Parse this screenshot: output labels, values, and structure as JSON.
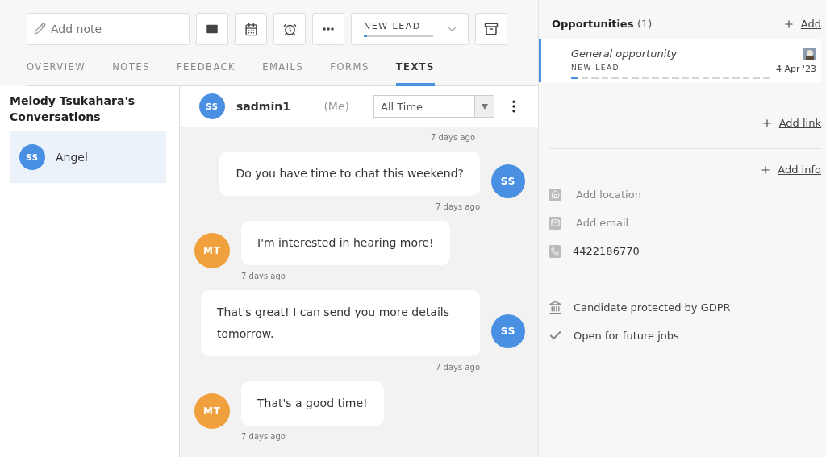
{
  "toolbar": {
    "note": {
      "placeholder": "Add note"
    },
    "stage": {
      "label": "NEW LEAD",
      "level": 0.05
    }
  },
  "tabs": [
    {
      "label": "OVERVIEW",
      "selected": false
    },
    {
      "label": "NOTES",
      "selected": false
    },
    {
      "label": "FEEDBACK",
      "selected": false
    },
    {
      "label": "EMAILS",
      "selected": false
    },
    {
      "label": "FORMS",
      "selected": false
    },
    {
      "label": "TEXTS",
      "selected": true
    }
  ],
  "conversations": {
    "title": "Melody Tsukahara's Conversations",
    "items": [
      {
        "initials": "SS",
        "name": "Angel",
        "color": "#4a90e2",
        "selected": true
      }
    ]
  },
  "chat": {
    "user": {
      "initials": "SS",
      "name": "sadmin1",
      "note": "(Me)",
      "color": "#4a90e2"
    },
    "period": "All Time",
    "messages": [
      {
        "kind": "time",
        "time": "7 days ago"
      },
      {
        "kind": "out",
        "text": "Do you have time to chat this weekend?",
        "time": "7 days ago",
        "initials": "SS",
        "color": "#4a90e2"
      },
      {
        "kind": "in",
        "text": "I'm interested in hearing more!",
        "time": "7 days ago",
        "initials": "MT",
        "color": "#f0a03c"
      },
      {
        "kind": "out",
        "text": "That's great! I can send you more details tomorrow.",
        "time": "7 days ago",
        "initials": "SS",
        "color": "#4a90e2"
      },
      {
        "kind": "in",
        "text": "That's a good time!",
        "time": "7 days ago",
        "initials": "MT",
        "color": "#f0a03c"
      }
    ]
  },
  "opportunities": {
    "title": "Opportunities",
    "count": "(1)",
    "add": "Add",
    "items": [
      {
        "name": "General opportunity",
        "stage": "NEW LEAD",
        "date": "4 Apr '23",
        "level": 0.05
      }
    ]
  },
  "links": {
    "add": "Add link"
  },
  "info": {
    "add": "Add info",
    "items": [
      {
        "kind": "location",
        "text": "Add location",
        "empty": true
      },
      {
        "kind": "email",
        "text": "Add email",
        "empty": true
      },
      {
        "kind": "phone",
        "text": "4422186770",
        "empty": false
      }
    ]
  },
  "flags": [
    {
      "kind": "gdpr",
      "text": "Candidate protected by GDPR"
    },
    {
      "kind": "check",
      "text": "Open for future jobs"
    }
  ]
}
